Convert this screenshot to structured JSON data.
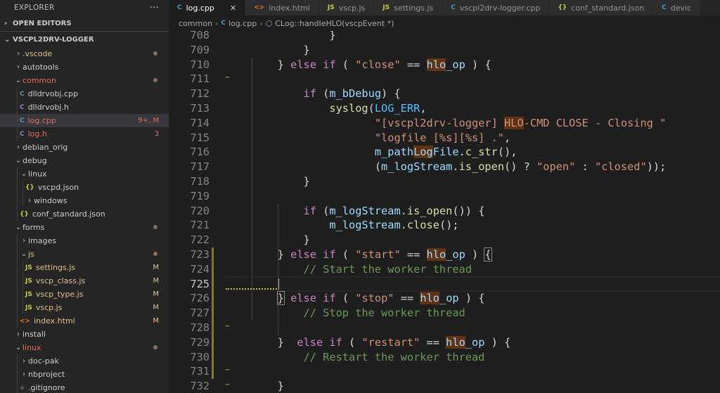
{
  "sidebar": {
    "title": "EXPLORER",
    "more": "···",
    "open_editors": "OPEN EDITORS",
    "project": "VSCPL2DRV-LOGGER"
  },
  "tree": [
    {
      "depth": 0,
      "type": "folder",
      "open": false,
      "label": ".vscode",
      "color": "#e2c08d",
      "dot": true
    },
    {
      "depth": 0,
      "type": "folder",
      "open": false,
      "label": "autotools",
      "color": "#cccccc"
    },
    {
      "depth": 0,
      "type": "folder",
      "open": true,
      "label": "common",
      "color": "#e36f5e",
      "dot": true
    },
    {
      "depth": 1,
      "type": "file",
      "icon": "C",
      "iconColor": "#519aba",
      "label": "dlldrvobj.cpp",
      "color": "#cccccc"
    },
    {
      "depth": 1,
      "type": "file",
      "icon": "C",
      "iconColor": "#a074c4",
      "label": "dlldrvobj.h",
      "color": "#cccccc"
    },
    {
      "depth": 1,
      "type": "file",
      "icon": "C",
      "iconColor": "#519aba",
      "label": "log.cpp",
      "color": "#e36f5e",
      "badge": "9+, M",
      "badgeColor": "#e36f5e",
      "selected": true
    },
    {
      "depth": 1,
      "type": "file",
      "icon": "C",
      "iconColor": "#a074c4",
      "label": "log.h",
      "color": "#e36f5e",
      "badge": "3",
      "badgeColor": "#e36f5e"
    },
    {
      "depth": 0,
      "type": "folder",
      "open": false,
      "label": "debian_orig",
      "color": "#cccccc"
    },
    {
      "depth": 0,
      "type": "folder",
      "open": true,
      "label": "debug",
      "color": "#cccccc"
    },
    {
      "depth": 1,
      "type": "folder",
      "open": true,
      "label": "linux",
      "color": "#cccccc"
    },
    {
      "depth": 2,
      "type": "file",
      "icon": "{}",
      "iconColor": "#cbcb41",
      "label": "vscpd.json",
      "color": "#cccccc"
    },
    {
      "depth": 2,
      "type": "folder",
      "open": false,
      "label": "windows",
      "color": "#cccccc"
    },
    {
      "depth": 1,
      "type": "file",
      "icon": "{}",
      "iconColor": "#cbcb41",
      "label": "conf_standard.json",
      "color": "#cccccc"
    },
    {
      "depth": 0,
      "type": "folder",
      "open": true,
      "label": "forms",
      "color": "#cccccc",
      "dot": true
    },
    {
      "depth": 1,
      "type": "folder",
      "open": false,
      "label": "images",
      "color": "#cccccc"
    },
    {
      "depth": 1,
      "type": "folder",
      "open": true,
      "label": "js",
      "color": "#e2c08d",
      "dot": true
    },
    {
      "depth": 2,
      "type": "file",
      "icon": "JS",
      "iconColor": "#cbcb41",
      "label": "settings.js",
      "color": "#e2c08d",
      "badge": "M",
      "badgeColor": "#e2c08d"
    },
    {
      "depth": 2,
      "type": "file",
      "icon": "JS",
      "iconColor": "#cbcb41",
      "label": "vscp_class.js",
      "color": "#e2c08d",
      "badge": "M",
      "badgeColor": "#e2c08d"
    },
    {
      "depth": 2,
      "type": "file",
      "icon": "JS",
      "iconColor": "#cbcb41",
      "label": "vscp_type.js",
      "color": "#e2c08d",
      "badge": "M",
      "badgeColor": "#e2c08d"
    },
    {
      "depth": 2,
      "type": "file",
      "icon": "JS",
      "iconColor": "#cbcb41",
      "label": "vscp.js",
      "color": "#e2c08d",
      "badge": "M",
      "badgeColor": "#e2c08d"
    },
    {
      "depth": 1,
      "type": "file",
      "icon": "<>",
      "iconColor": "#e37933",
      "label": "index.html",
      "color": "#e2c08d",
      "badge": "M",
      "badgeColor": "#e2c08d"
    },
    {
      "depth": 0,
      "type": "folder",
      "open": false,
      "label": "install",
      "color": "#cccccc"
    },
    {
      "depth": 0,
      "type": "folder",
      "open": true,
      "label": "linux",
      "color": "#e36f5e",
      "dot": true
    },
    {
      "depth": 1,
      "type": "folder",
      "open": false,
      "label": "doc-pak",
      "color": "#cccccc"
    },
    {
      "depth": 1,
      "type": "folder",
      "open": false,
      "label": "nbproject",
      "color": "#cccccc"
    },
    {
      "depth": 1,
      "type": "file",
      "icon": "◆",
      "iconColor": "#41535b",
      "label": ".gitignore",
      "color": "#cccccc"
    }
  ],
  "tabs": [
    {
      "icon": "C",
      "iconColor": "#519aba",
      "label": "log.cpp",
      "active": true,
      "close": "✕"
    },
    {
      "icon": "<>",
      "iconColor": "#e37933",
      "label": "index.html"
    },
    {
      "icon": "JS",
      "iconColor": "#cbcb41",
      "label": "vscp.js"
    },
    {
      "icon": "JS",
      "iconColor": "#cbcb41",
      "label": "settings.js"
    },
    {
      "icon": "C",
      "iconColor": "#519aba",
      "label": "vscpl2drv-logger.cpp"
    },
    {
      "icon": "{}",
      "iconColor": "#cbcb41",
      "label": "conf_standard.json"
    },
    {
      "icon": "C",
      "iconColor": "#519aba",
      "label": "devic"
    }
  ],
  "breadcrumb": {
    "folder": "common",
    "file_icon": "C",
    "file": "log.cpp",
    "symbol": "CLog::handleHLO(vscpEvent *)"
  },
  "editor": {
    "current_line": 725,
    "lines": [
      {
        "n": 708,
        "seg": [
          [
            "p",
            "                }"
          ]
        ]
      },
      {
        "n": 709,
        "seg": [
          [
            "p",
            "            }"
          ]
        ]
      },
      {
        "n": 710,
        "seg": [
          [
            "p",
            "        } "
          ],
          [
            "c",
            "else"
          ],
          [
            "p",
            " "
          ],
          [
            "c",
            "if"
          ],
          [
            "p",
            " ( "
          ],
          [
            "s",
            "\"close\""
          ],
          [
            "p",
            " == "
          ],
          [
            "vh",
            "hlo"
          ],
          [
            "v",
            "_op"
          ],
          [
            "p",
            " ) {"
          ]
        ]
      },
      {
        "n": 711,
        "tilde": true,
        "seg": []
      },
      {
        "n": 712,
        "seg": [
          [
            "p",
            "            "
          ],
          [
            "c",
            "if"
          ],
          [
            "p",
            " ("
          ],
          [
            "v",
            "m_bDebug"
          ],
          [
            "p",
            ") {"
          ]
        ]
      },
      {
        "n": 713,
        "seg": [
          [
            "p",
            "                "
          ],
          [
            "f",
            "syslog"
          ],
          [
            "p",
            "("
          ],
          [
            "m",
            "LOG_ERR"
          ],
          [
            "p",
            ","
          ]
        ]
      },
      {
        "n": 714,
        "seg": [
          [
            "p",
            "                       "
          ],
          [
            "s",
            "\"[vscpl2drv-logger] "
          ],
          [
            "sh",
            "HLO"
          ],
          [
            "s",
            "-CMD CLOSE - Closing \""
          ]
        ]
      },
      {
        "n": 715,
        "seg": [
          [
            "p",
            "                       "
          ],
          [
            "s",
            "\"logfile [%s][%s] .\""
          ],
          [
            "p",
            ","
          ]
        ]
      },
      {
        "n": 716,
        "seg": [
          [
            "p",
            "                       "
          ],
          [
            "v",
            "m_path"
          ],
          [
            "vh",
            "Log"
          ],
          [
            "v",
            "File"
          ],
          [
            "p",
            "."
          ],
          [
            "f",
            "c_str"
          ],
          [
            "p",
            "(),"
          ]
        ]
      },
      {
        "n": 717,
        "seg": [
          [
            "p",
            "                       ("
          ],
          [
            "v",
            "m_logStream"
          ],
          [
            "p",
            "."
          ],
          [
            "f",
            "is_open"
          ],
          [
            "p",
            "() ? "
          ],
          [
            "s",
            "\"open\""
          ],
          [
            "p",
            " : "
          ],
          [
            "s",
            "\"closed\""
          ],
          [
            "p",
            "));"
          ]
        ]
      },
      {
        "n": 718,
        "seg": [
          [
            "p",
            "            }"
          ]
        ]
      },
      {
        "n": 719,
        "seg": []
      },
      {
        "n": 720,
        "seg": [
          [
            "p",
            "            "
          ],
          [
            "c",
            "if"
          ],
          [
            "p",
            " ("
          ],
          [
            "v",
            "m_logStream"
          ],
          [
            "p",
            "."
          ],
          [
            "f",
            "is_open"
          ],
          [
            "p",
            "()) {"
          ]
        ]
      },
      {
        "n": 721,
        "seg": [
          [
            "p",
            "                "
          ],
          [
            "v",
            "m_logStream"
          ],
          [
            "p",
            "."
          ],
          [
            "f",
            "close"
          ],
          [
            "p",
            "();"
          ]
        ]
      },
      {
        "n": 722,
        "seg": [
          [
            "p",
            "            }"
          ]
        ]
      },
      {
        "n": 723,
        "mod": true,
        "seg": [
          [
            "p",
            "        } "
          ],
          [
            "c",
            "else"
          ],
          [
            "p",
            " "
          ],
          [
            "c",
            "if"
          ],
          [
            "p",
            " ( "
          ],
          [
            "s",
            "\"start\""
          ],
          [
            "p",
            " == "
          ],
          [
            "vh",
            "hlo"
          ],
          [
            "v",
            "_op"
          ],
          [
            "p",
            " ) "
          ],
          [
            "pb",
            "{"
          ]
        ]
      },
      {
        "n": 724,
        "mod": true,
        "seg": [
          [
            "p",
            "            "
          ],
          [
            "g",
            "// Start the worker thread"
          ]
        ]
      },
      {
        "n": 725,
        "mod": true,
        "squig": true,
        "seg": []
      },
      {
        "n": 726,
        "mod": true,
        "seg": [
          [
            "p",
            "        "
          ],
          [
            "pb",
            "}"
          ],
          [
            "p",
            " "
          ],
          [
            "c",
            "else"
          ],
          [
            "p",
            " "
          ],
          [
            "c",
            "if"
          ],
          [
            "p",
            " ( "
          ],
          [
            "s",
            "\"stop\""
          ],
          [
            "p",
            " == "
          ],
          [
            "vh",
            "hlo"
          ],
          [
            "v",
            "_op"
          ],
          [
            "p",
            " ) {"
          ]
        ]
      },
      {
        "n": 727,
        "mod": true,
        "seg": [
          [
            "p",
            "            "
          ],
          [
            "g",
            "// Stop the worker thread"
          ]
        ]
      },
      {
        "n": 728,
        "mod": true,
        "tilde": true,
        "seg": []
      },
      {
        "n": 729,
        "mod": true,
        "seg": [
          [
            "p",
            "        }  "
          ],
          [
            "c",
            "else"
          ],
          [
            "p",
            " "
          ],
          [
            "c",
            "if"
          ],
          [
            "p",
            " ( "
          ],
          [
            "s",
            "\"restart\""
          ],
          [
            "p",
            " == "
          ],
          [
            "vh",
            "hlo"
          ],
          [
            "v",
            "_op"
          ],
          [
            "p",
            " ) {"
          ]
        ]
      },
      {
        "n": 730,
        "mod": true,
        "seg": [
          [
            "p",
            "            "
          ],
          [
            "g",
            "// Restart the worker thread"
          ]
        ]
      },
      {
        "n": 731,
        "mod": true,
        "tilde": true,
        "seg": []
      },
      {
        "n": 732,
        "tilde": true,
        "seg": [
          [
            "p",
            "        }"
          ]
        ]
      }
    ]
  }
}
